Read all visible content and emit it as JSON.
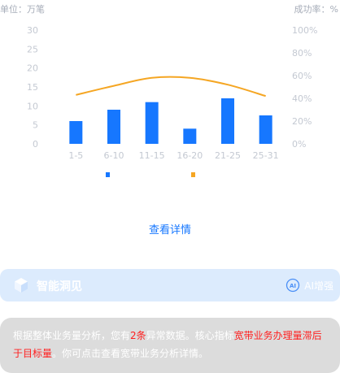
{
  "header": {
    "unit_left": "单位：万笔",
    "unit_right": "成功率：%"
  },
  "chart_data": {
    "type": "bar",
    "categories": [
      "1-5",
      "6-10",
      "11-15",
      "16-20",
      "21-25",
      "25-31"
    ],
    "series": [
      {
        "type": "bar",
        "axis": "left",
        "color": "#1677ff",
        "values": [
          6,
          9,
          11,
          4,
          12,
          7.5
        ]
      },
      {
        "type": "line",
        "axis": "right",
        "color": "#f5a623",
        "values": [
          43,
          51,
          58,
          58,
          52,
          42
        ]
      }
    ],
    "y_left": {
      "ticks": [
        "0",
        "5",
        "10",
        "15",
        "20",
        "25",
        "30"
      ],
      "range": [
        0,
        30
      ]
    },
    "y_right": {
      "ticks": [
        "0%",
        "20%",
        "40%",
        "60%",
        "80%",
        "100%"
      ],
      "range": [
        0,
        100
      ]
    },
    "grid": false,
    "legend_position": "bottom"
  },
  "detail_link": "查看详情",
  "insight": {
    "title": "智能洞见",
    "ai_button": "AI增强",
    "icon": "cube-icon"
  },
  "message": {
    "t1": "根据整体业务量分析，您有",
    "h1": "2条",
    "t2": "异常数据。核心指标",
    "h2": "宽带业务办理量滞后于目标量",
    "t3": "。你可点击查看宽带业务分析详情。"
  },
  "colors": {
    "accent": "#1677ff",
    "line": "#f5a623",
    "highlight": "#ff1f1f"
  }
}
